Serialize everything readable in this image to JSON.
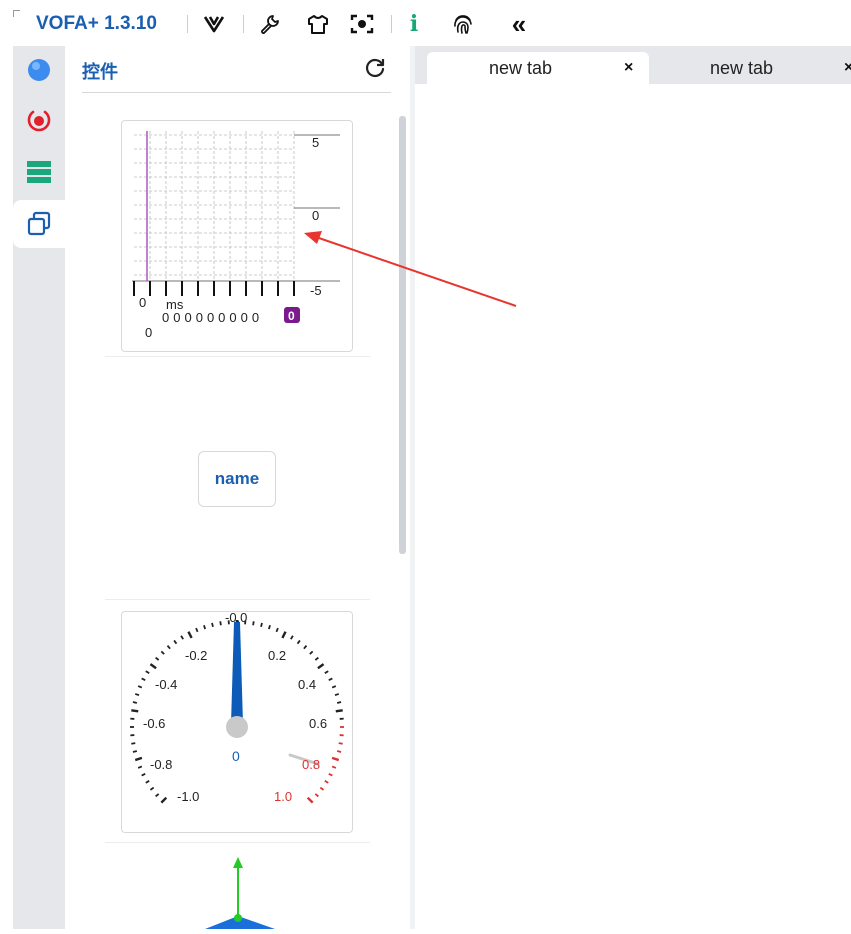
{
  "app": {
    "title": "VOFA+ 1.3.10"
  },
  "toolbar": {
    "icons": [
      "vofa-logo-icon",
      "wrench-icon",
      "shirt-icon",
      "capture-icon",
      "info-icon",
      "fingerprint-icon",
      "collapse-icon"
    ],
    "info_label": "i",
    "collapse_label": "«"
  },
  "rail": {
    "items": [
      "connect-dot-icon",
      "record-icon",
      "list-icon",
      "widgets-icon"
    ],
    "active": "widgets-icon"
  },
  "panel": {
    "title": "控件",
    "waveform": {
      "y_labels": [
        "5",
        "0",
        "-5"
      ],
      "x_start": "0",
      "unit": "ms",
      "counters": [
        "0",
        "0",
        "0",
        "0",
        "0",
        "0",
        "0",
        "0",
        "0"
      ],
      "highlight_value": "0",
      "origin": "0",
      "colors": {
        "cursor": "#b062c4",
        "highlight": "#7a1a8c"
      }
    },
    "button": {
      "label": "name"
    },
    "gauge": {
      "left_labels": [
        "-0.2",
        "-0.4",
        "-0.6",
        "-0.8",
        "-1.0"
      ],
      "right_labels": [
        "0.2",
        "0.4",
        "0.6"
      ],
      "top_label": "-0.0",
      "red_labels": [
        "0.8",
        "1.0"
      ],
      "value": "0",
      "colors": {
        "needle": "#0d5bb8",
        "danger": "#e03030"
      }
    },
    "axis3d": {
      "colors": {
        "axis": "#22cc22",
        "plane": "#1a6fd8"
      }
    }
  },
  "tabs": [
    {
      "label": "new tab",
      "active": true,
      "close": "×"
    },
    {
      "label": "new tab",
      "active": false,
      "close": "×"
    }
  ],
  "colors": {
    "accent": "#1a5fb0",
    "rail_bg": "#e5e7ea",
    "record": "#e0202a",
    "list": "#1aa87a",
    "arrow": "#e8352e"
  }
}
